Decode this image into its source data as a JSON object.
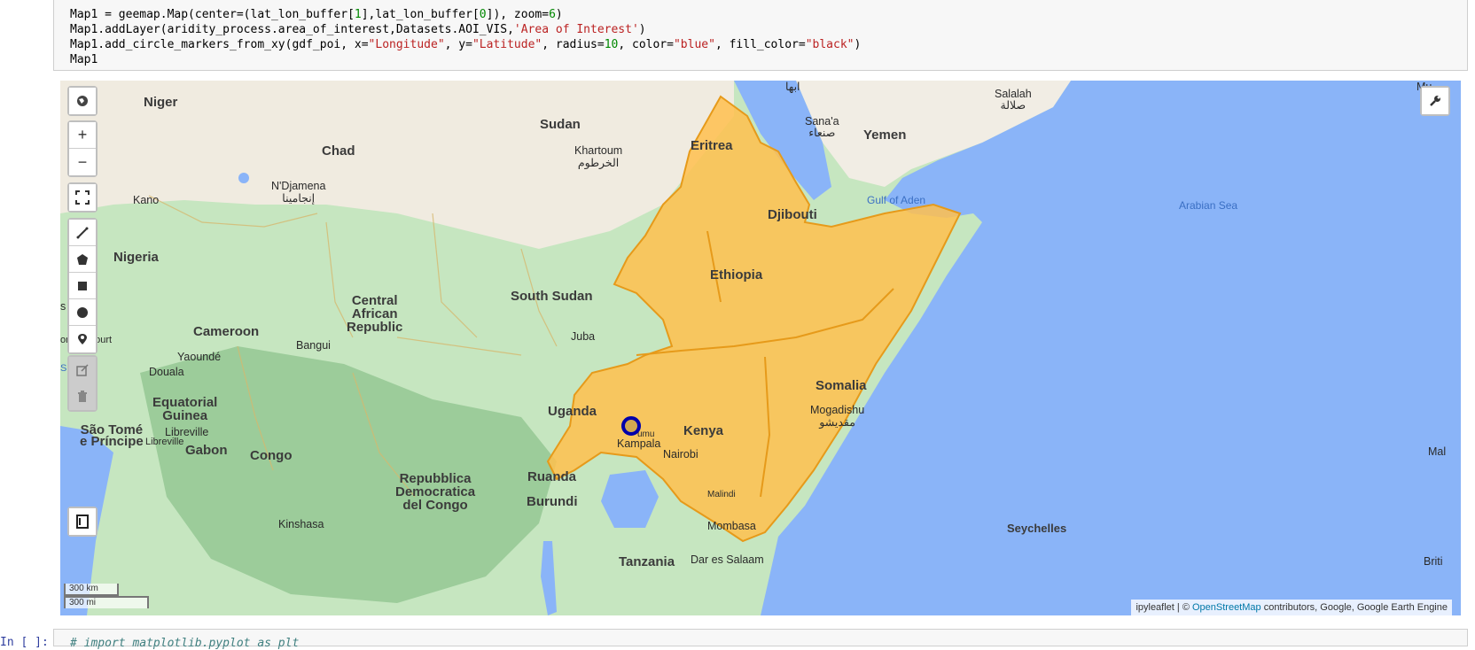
{
  "code": {
    "line1_a": "Map1 = geemap.Map(center=(lat_lon_buffer[",
    "line1_n1": "1",
    "line1_b": "],lat_lon_buffer[",
    "line1_n2": "0",
    "line1_c": "]), zoom=",
    "line1_n3": "6",
    "line1_d": ")",
    "line2_a": "Map1.addLayer(aridity_process.area_of_interest,Datasets.AOI_VIS,",
    "line2_s": "'Area of Interest'",
    "line2_b": ")",
    "line3_a": "Map1.add_circle_markers_from_xy(gdf_poi, x=",
    "line3_s1": "\"Longitude\"",
    "line3_b": ", y=",
    "line3_s2": "\"Latitude\"",
    "line3_c": ", radius=",
    "line3_n": "10",
    "line3_d": ", color=",
    "line3_s3": "\"blue\"",
    "line3_e": ", fill_color=",
    "line3_s4": "\"black\"",
    "line3_f": ")",
    "line4": "Map1"
  },
  "map": {
    "countries": {
      "niger": "Niger",
      "sudan": "Sudan",
      "chad": "Chad",
      "eritrea": "Eritrea",
      "yemen": "Yemen",
      "djibouti": "Djibouti",
      "nigeria": "Nigeria",
      "ethiopia": "Ethiopia",
      "south_sudan": "South Sudan",
      "car_1": "Central",
      "car_2": "African",
      "car_3": "Republic",
      "cameroon": "Cameroon",
      "somalia": "Somalia",
      "eq_guinea_1": "Equatorial",
      "eq_guinea_2": "Guinea",
      "uganda": "Uganda",
      "kenya": "Kenya",
      "sao_tome_1": "São Tomé",
      "sao_tome_2": "e Príncipe",
      "gabon": "Gabon",
      "congo": "Congo",
      "drc_1": "Repubblica",
      "drc_2": "Democratica",
      "drc_3": "del Congo",
      "rwanda": "Ruanda",
      "burundi": "Burundi",
      "tanzania": "Tanzania",
      "seychelles": "Seychelles"
    },
    "cities": {
      "abha": "ابها",
      "salalah_1": "Salalah",
      "salalah_2": "صلالة",
      "sanaa_1": "Sana'a",
      "sanaa_2": "صنعاء",
      "khartoum_1": "Khartoum",
      "khartoum_2": "الخرطوم",
      "kano": "Kano",
      "ndjamena_1": "N'Djamena",
      "ndjamena_2": "إنجامينا",
      "juba": "Juba",
      "bangui": "Bangui",
      "port_harcourt": "ort Harcourt",
      "yaounde": "Yaoundé",
      "douala": "Douala",
      "libreville_1": "Libreville",
      "libreville_2": "Libreville",
      "mogadishu_1": "Mogadishu",
      "mogadishu_2": "مقديشو",
      "kampala": "Kampala",
      "kisumu": "umu",
      "nairobi": "Nairobi",
      "malindi": "Malindi",
      "mombasa": "Mombasa",
      "kinshasa": "Kinshasa",
      "dar_es_salaam": "Dar es Salaam",
      "mu_edge": "Mu",
      "s_edge": "s",
      "su_edge": "Su",
      "mal_edge": "Mal",
      "brit_edge": "Briti"
    },
    "seas": {
      "gulf_of_aden": "Gulf of Aden",
      "arabian_sea": "Arabian Sea"
    },
    "scale": {
      "km": "300 km",
      "mi": "300 mi"
    },
    "attribution": {
      "prefix": "ipyleaflet | © ",
      "osm": "OpenStreetMap",
      "suffix": " contributors, Google, Google Earth Engine"
    },
    "controls": {
      "zoom_in": "+",
      "zoom_out": "−"
    },
    "colors": {
      "water": "#8ab4f8",
      "aoi_fill": "#ffc04d",
      "aoi_stroke": "#e69a1a",
      "marker": "#0000aa"
    }
  },
  "next_cell": {
    "prompt": "In [ ]:",
    "code": "# import matplotlib.pyplot as plt"
  }
}
